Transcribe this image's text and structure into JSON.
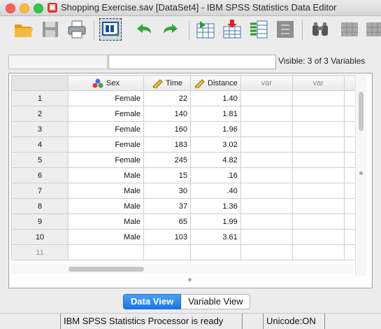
{
  "window": {
    "title": "Shopping Exercise.sav [DataSet4] - IBM SPSS Statistics Data Editor"
  },
  "toolbar": {
    "buttons": [
      "open-icon",
      "save-icon",
      "print-icon",
      "recall-dialog-icon",
      "undo-icon",
      "redo-icon",
      "goto-case-icon",
      "goto-variable-icon",
      "variables-icon",
      "run-descriptives-icon",
      "find-icon",
      "insert-cases-icon"
    ]
  },
  "cell_editor": {
    "name": "",
    "value": "",
    "visible": "Visible: 3 of 3 Variables"
  },
  "grid": {
    "columns": [
      {
        "label": "Sex",
        "type": "nominal"
      },
      {
        "label": "Time",
        "type": "scale"
      },
      {
        "label": "Distance",
        "type": "scale"
      },
      {
        "label": "var",
        "type": "empty"
      },
      {
        "label": "var",
        "type": "empty"
      }
    ],
    "rows": [
      {
        "n": "1",
        "sex": "Female",
        "time": "22",
        "distance": "1.40"
      },
      {
        "n": "2",
        "sex": "Female",
        "time": "140",
        "distance": "1.81"
      },
      {
        "n": "3",
        "sex": "Female",
        "time": "160",
        "distance": "1.96"
      },
      {
        "n": "4",
        "sex": "Female",
        "time": "183",
        "distance": "3.02"
      },
      {
        "n": "5",
        "sex": "Female",
        "time": "245",
        "distance": "4.82"
      },
      {
        "n": "6",
        "sex": "Male",
        "time": "15",
        "distance": ".16"
      },
      {
        "n": "7",
        "sex": "Male",
        "time": "30",
        "distance": ".40"
      },
      {
        "n": "8",
        "sex": "Male",
        "time": "37",
        "distance": "1.36"
      },
      {
        "n": "9",
        "sex": "Male",
        "time": "65",
        "distance": "1.99"
      },
      {
        "n": "10",
        "sex": "Male",
        "time": "103",
        "distance": "3.61"
      },
      {
        "n": "11",
        "sex": "",
        "time": "",
        "distance": ""
      }
    ]
  },
  "tabs": {
    "data_view": "Data View",
    "variable_view": "Variable View"
  },
  "status": {
    "processor": "IBM SPSS Statistics Processor is ready",
    "unicode": "Unicode:ON"
  },
  "colors": {
    "accent": "#1a74e8",
    "close": "#fc605c",
    "minimize": "#fdbc40",
    "maximize": "#34c84a"
  }
}
